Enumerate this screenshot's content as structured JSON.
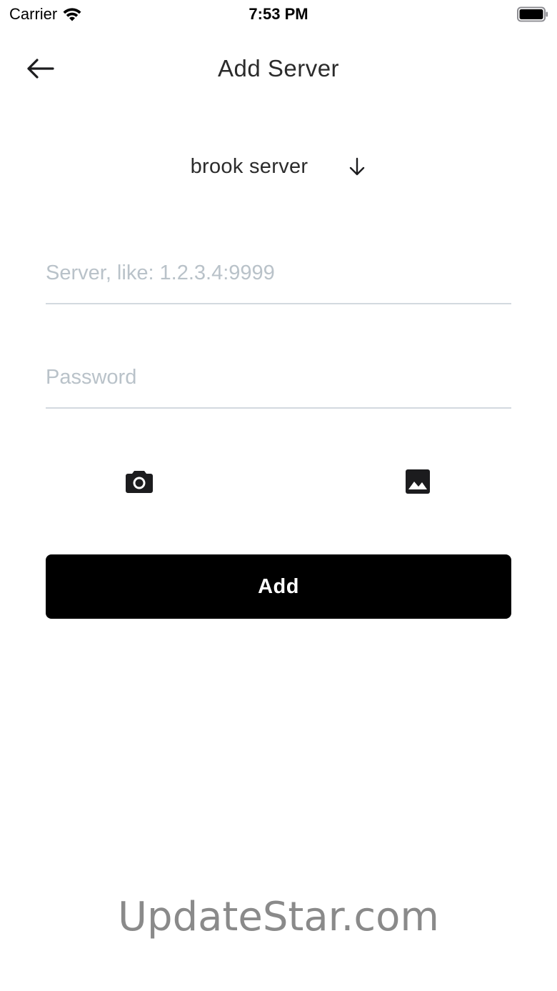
{
  "status_bar": {
    "carrier": "Carrier",
    "time": "7:53 PM",
    "wifi_icon": "wifi-icon",
    "battery_icon": "battery-icon"
  },
  "nav": {
    "title": "Add Server",
    "back_icon": "arrow-left-icon"
  },
  "server_type": {
    "selected": "brook server",
    "dropdown_icon": "arrow-down-icon"
  },
  "form": {
    "server_placeholder": "Server, like: 1.2.3.4:9999",
    "server_value": "",
    "password_placeholder": "Password",
    "password_value": ""
  },
  "actions": {
    "camera_icon": "camera-icon",
    "image_icon": "image-icon",
    "add_label": "Add"
  },
  "watermark": {
    "text": "UpdateStar.com"
  },
  "colors": {
    "primary_button": "#000000",
    "placeholder": "#b9c2c9",
    "divider": "#d3d9df",
    "watermark": "#8a8a8a"
  }
}
